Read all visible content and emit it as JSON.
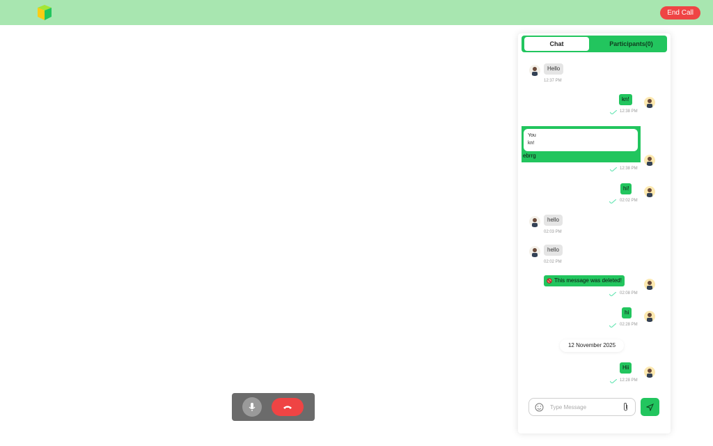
{
  "header": {
    "end_call_label": "End Call"
  },
  "tabs": {
    "chat": "Chat",
    "participants": "Participants(0)"
  },
  "messages": [
    {
      "direction": "in",
      "text": "Hello",
      "time": "12:37 PM"
    },
    {
      "direction": "out",
      "text": "kn!",
      "time": "12:38 PM"
    },
    {
      "direction": "out-reply",
      "reply_sender": "You",
      "reply_quote": "kn!",
      "text": "ebrrg",
      "time": "12:38 PM"
    },
    {
      "direction": "out",
      "text": "hi!",
      "time": "02:02 PM"
    },
    {
      "direction": "in",
      "text": "hello",
      "time": "02:03 PM"
    },
    {
      "direction": "in",
      "text": "hello",
      "time": "02:02 PM"
    },
    {
      "direction": "out",
      "text": "This message was deleted!",
      "time": "02:08 PM",
      "icon": "blocked-icon"
    },
    {
      "direction": "out",
      "text": "hi",
      "time": "02:28 PM"
    },
    {
      "direction": "out",
      "text": "Hii",
      "time": "12:28 PM"
    }
  ],
  "date_divider": "12 November 2025",
  "composer": {
    "placeholder": "Type Message"
  },
  "colors": {
    "accent": "#22c55e",
    "header_bg": "#a8e6b0",
    "danger": "#ef4444"
  }
}
